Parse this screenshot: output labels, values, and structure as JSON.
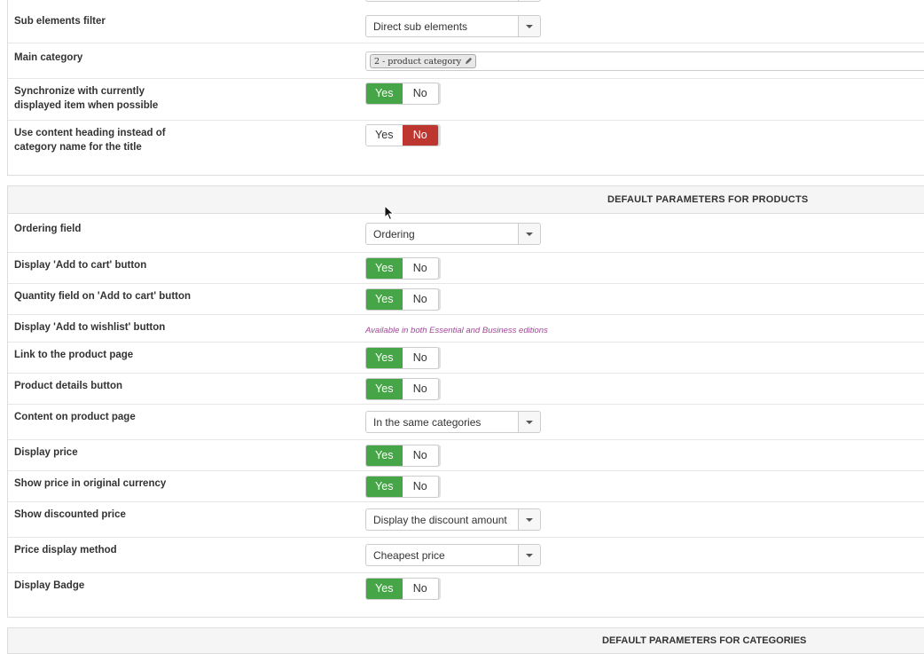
{
  "panel1": {
    "rows": [
      {
        "label": "Sub elements filter",
        "select": "Direct sub elements"
      },
      {
        "label": "Main category",
        "tag": "2 - product category"
      },
      {
        "label": "Synchronize with currently displayed item when possible",
        "toggle": {
          "yes": "Yes",
          "no": "No",
          "selected": "Yes"
        }
      },
      {
        "label": "Use content heading instead of category name for the title",
        "toggle": {
          "yes": "Yes",
          "no": "No",
          "selected": "No"
        }
      }
    ]
  },
  "panel2": {
    "title": "DEFAULT PARAMETERS FOR PRODUCTS",
    "rows": [
      {
        "label": "Ordering field",
        "select": "Ordering"
      },
      {
        "label": "Display 'Add to cart' button",
        "toggle": {
          "yes": "Yes",
          "no": "No",
          "selected": "Yes"
        }
      },
      {
        "label": "Quantity field on 'Add to cart' button",
        "toggle": {
          "yes": "Yes",
          "no": "No",
          "selected": "Yes"
        }
      },
      {
        "label": "Display 'Add to wishlist' button",
        "note": "Available in both Essential and Business editions"
      },
      {
        "label": "Link to the product page",
        "toggle": {
          "yes": "Yes",
          "no": "No",
          "selected": "Yes"
        }
      },
      {
        "label": "Product details button",
        "toggle": {
          "yes": "Yes",
          "no": "No",
          "selected": "Yes"
        }
      },
      {
        "label": "Content on product page",
        "select": "In the same categories"
      },
      {
        "label": "Display price",
        "toggle": {
          "yes": "Yes",
          "no": "No",
          "selected": "Yes"
        }
      },
      {
        "label": "Show price in original currency",
        "toggle": {
          "yes": "Yes",
          "no": "No",
          "selected": "Yes"
        }
      },
      {
        "label": "Show discounted price",
        "select": "Display the discount amount"
      },
      {
        "label": "Price display method",
        "select": "Cheapest price"
      },
      {
        "label": "Display Badge",
        "toggle": {
          "yes": "Yes",
          "no": "No",
          "selected": "Yes"
        }
      }
    ]
  },
  "panel3": {
    "title": "DEFAULT PARAMETERS FOR CATEGORIES"
  },
  "colors": {
    "yes_active": "#46a546",
    "no_active": "#bd362f",
    "note_text": "#a04898",
    "header_bg": "#f5f5f5"
  },
  "icons": {
    "tag_edit": "pencil-icon",
    "select_arrow": "caret-down-icon",
    "cursor": "mouse-pointer-icon"
  }
}
